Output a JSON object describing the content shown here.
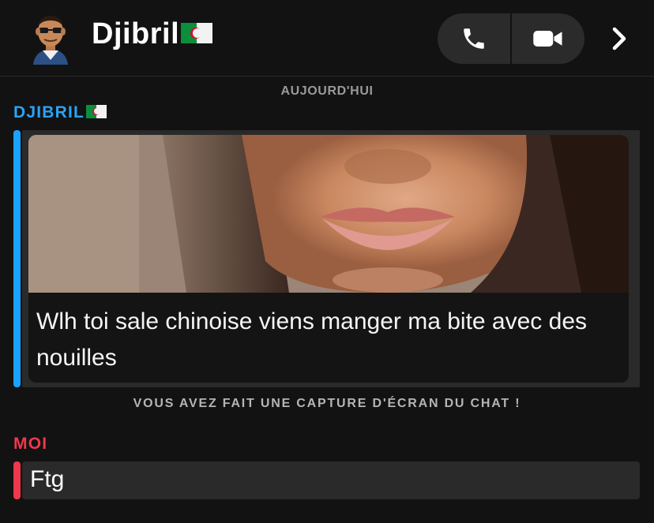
{
  "header": {
    "contact_name": "Djibril",
    "flag_emoji_name": "algeria-flag",
    "avatar_icon": "bitmoji-avatar",
    "call_icon": "phone-icon",
    "video_icon": "video-camera-icon",
    "more_icon": "chevron-right-icon"
  },
  "chat": {
    "date_label": "AUJOURD'HUI",
    "their_sender": "DJIBRIL",
    "their_caption": "Wlh toi sale chinoise viens manger ma bite avec des nouilles",
    "screenshot_notice": "VOUS AVEZ FAIT UNE CAPTURE D'ÉCRAN DU CHAT !",
    "my_sender": "MOI",
    "my_message": "Ftg"
  },
  "colors": {
    "background": "#121212",
    "their_accent": "#2ba3f7",
    "my_accent": "#f0374d",
    "bubble": "#2a2a2a"
  }
}
